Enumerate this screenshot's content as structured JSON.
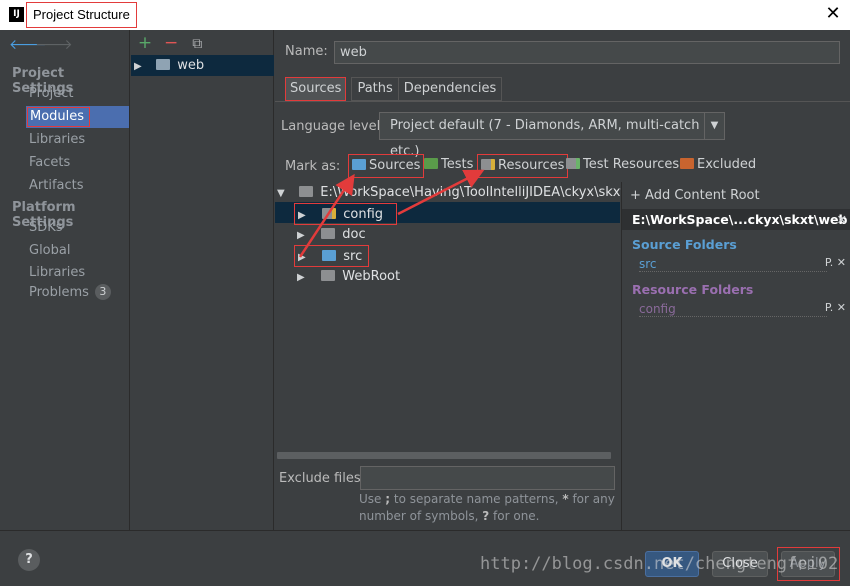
{
  "window": {
    "title": "Project Structure",
    "app_icon": "IJ",
    "close_glyph": "✕"
  },
  "nav": {
    "back_glyph": "🡐",
    "forward_glyph": "🡒",
    "sections": [
      {
        "title": "Project Settings",
        "items": [
          "Project",
          "Modules",
          "Libraries",
          "Facets",
          "Artifacts"
        ]
      },
      {
        "title": "Platform Settings",
        "items": [
          "SDKs",
          "Global Libraries"
        ]
      }
    ],
    "problems": {
      "label": "Problems",
      "count": "3"
    },
    "selected": "Modules"
  },
  "modules": {
    "add_glyph": "+",
    "remove_glyph": "−",
    "copy_glyph": "⧉",
    "items": [
      {
        "name": "web"
      }
    ]
  },
  "main": {
    "name_label": "Name:",
    "name_value": "web",
    "tabs": [
      "Sources",
      "Paths",
      "Dependencies"
    ],
    "active_tab": "Sources",
    "language_level_label": "Language level:",
    "language_level_value": "Project default (7 - Diamonds, ARM, multi-catch etc.)",
    "mark_as_label": "Mark as:",
    "mark_buttons": [
      "Sources",
      "Tests",
      "Resources",
      "Test Resources",
      "Excluded"
    ],
    "tree_root": "E:\\WorkSpace\\Having\\ToolIntelliJIDEA\\ckyx\\skxt\\web",
    "tree_children": [
      "config",
      "doc",
      "src",
      "WebRoot"
    ],
    "exclude_label": "Exclude files:",
    "exclude_hint_1": "Use ",
    "exclude_hint_sep": ";",
    "exclude_hint_2": " to separate name patterns, ",
    "exclude_hint_star": "*",
    "exclude_hint_3": " for any number of symbols, ",
    "exclude_hint_q": "?",
    "exclude_hint_4": " for one."
  },
  "content_root": {
    "add_label": "+ Add Content Root",
    "root_path": "E:\\WorkSpace\\...ckyx\\skxt\\web",
    "source_title": "Source Folders",
    "source_items": [
      "src"
    ],
    "resource_title": "Resource Folders",
    "resource_items": [
      "config"
    ],
    "entry_icons": "P. ✕",
    "remove_glyph": "✕"
  },
  "footer": {
    "help": "?",
    "ok": "OK",
    "close": "Close",
    "apply": "Apply",
    "watermark": "http://blog.csdn.net/chengtengfei02"
  },
  "colors": {
    "source": "#5a9fd4",
    "resource": "#9a6fb0",
    "tests": "#5a9b4a",
    "excluded": "#c8642f",
    "highlight": "#e23b3b"
  }
}
